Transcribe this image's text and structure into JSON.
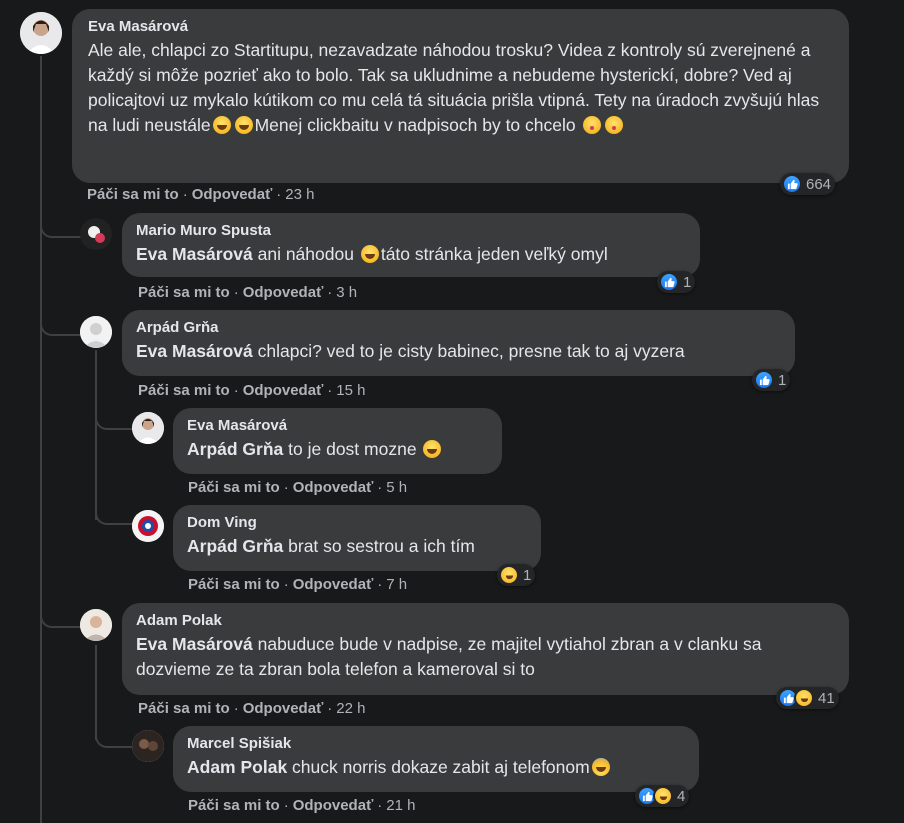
{
  "actions": {
    "like": "Páči sa mi to",
    "reply": "Odpovedať",
    "separator": "·"
  },
  "comments": [
    {
      "author": "Eva Masárová",
      "text": "Ale ale, chlapci zo Startitupu, nezavadzate náhodou trosku? Videa z kontroly sú zverejnené a každý si môže pozrieť ako to bolo. Tak sa ukludnime a nebudeme hysterickí, dobre? Ved aj policajtovi uz mykalo kútikom co mu celá tá situácia prišla vtipná. Tety na úradoch zvyšujú hlas na ludi neustále",
      "text_tail": "Menej clickbaitu v nadpisoch by to chcelo",
      "time": "23 h",
      "reactions": "664"
    },
    {
      "author": "Mario Muro Spusta",
      "mention": "Eva Masárová",
      "text": " ani náhodou ",
      "text_tail": "táto stránka jeden veľký omyl",
      "time": "3 h",
      "reactions": "1"
    },
    {
      "author": "Arpád Grňa",
      "mention": "Eva Masárová",
      "text": " chlapci? ved to je cisty babinec, presne tak to aj vyzera",
      "time": "15 h",
      "reactions": "1"
    },
    {
      "author": "Eva Masárová",
      "mention": "Arpád Grňa",
      "text": " to je dost mozne ",
      "time": "5 h"
    },
    {
      "author": "Dom Ving",
      "mention": "Arpád Grňa",
      "text": " brat so sestrou a ich tím",
      "time": "7 h",
      "reactions": "1"
    },
    {
      "author": "Adam Polak",
      "mention": "Eva Masárová",
      "text": " nabuduce bude v nadpise, ze majitel vytiahol zbran a v clanku sa dozvieme ze ta zbran bola telefon a kameroval si to",
      "time": "22 h",
      "reactions": "41"
    },
    {
      "author": "Marcel Spišiak",
      "mention": "Adam Polak",
      "text": " chuck norris dokaze zabit aj telefonom",
      "time": "21 h",
      "reactions": "4"
    }
  ]
}
